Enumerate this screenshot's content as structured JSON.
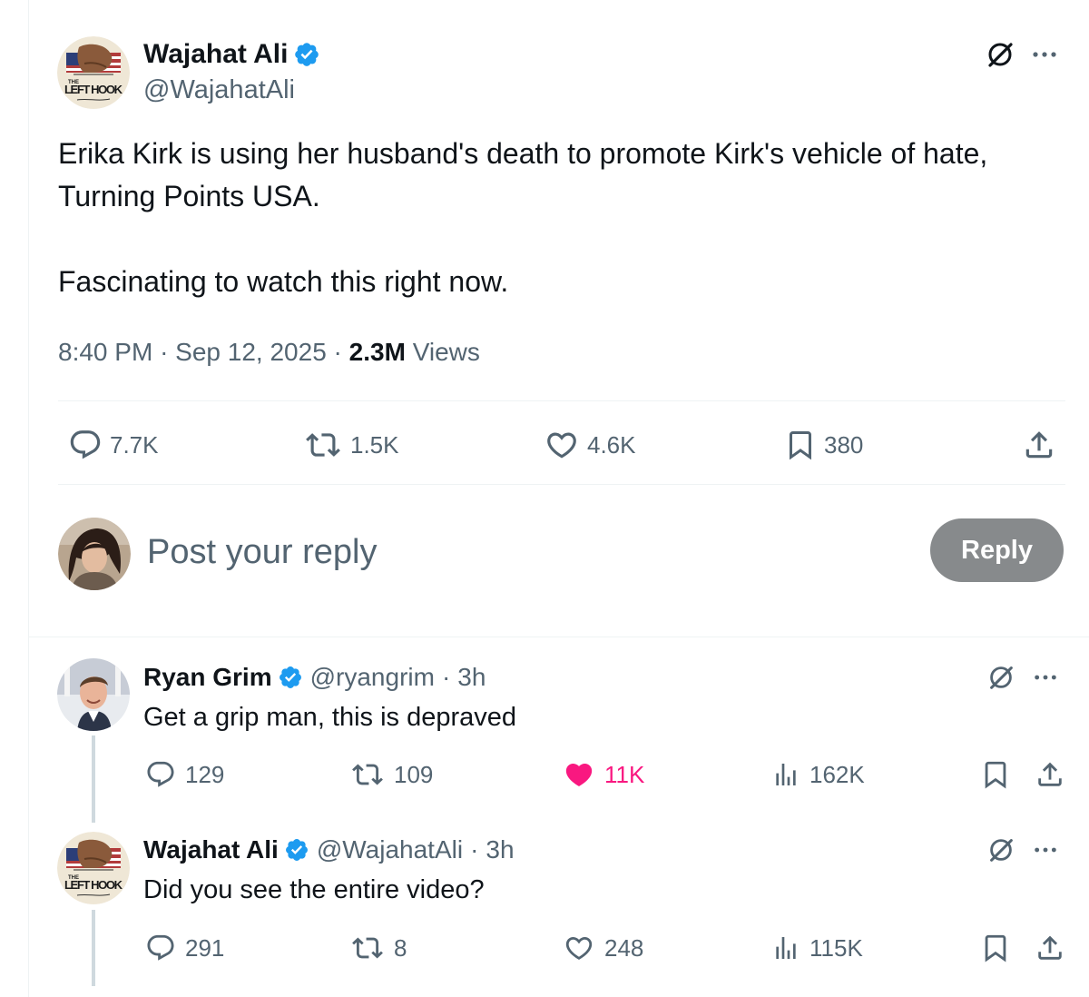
{
  "main_tweet": {
    "author_name": "Wajahat Ali",
    "author_handle": "@WajahatAli",
    "avatar_text_top": "THE",
    "avatar_text_main": "LEFT HOOK",
    "text_paragraphs": [
      "Erika Kirk is using her husband's death to promote Kirk's vehicle of hate, Turning Points USA.",
      "Fascinating to watch this right now."
    ],
    "time": "8:40 PM",
    "date": "Sep 12, 2025",
    "separator": "·",
    "views_count": "2.3M",
    "views_label": "Views",
    "stats": {
      "replies": "7.7K",
      "reposts": "1.5K",
      "likes": "4.6K",
      "bookmarks": "380"
    }
  },
  "composer": {
    "placeholder": "Post your reply",
    "button_label": "Reply"
  },
  "replies": [
    {
      "author_name": "Ryan Grim",
      "author_handle": "@ryangrim",
      "separator": "·",
      "time": "3h",
      "text": "Get a grip man, this is depraved",
      "stats": {
        "replies": "129",
        "reposts": "109",
        "likes": "11K",
        "views": "162K"
      },
      "liked": true
    },
    {
      "author_name": "Wajahat Ali",
      "author_handle": "@WajahatAli",
      "separator": "·",
      "time": "3h",
      "text": "Did you see the entire video?",
      "stats": {
        "replies": "291",
        "reposts": "8",
        "likes": "248",
        "views": "115K"
      },
      "liked": false
    }
  ],
  "colors": {
    "verified": "#1d9bf0",
    "muted": "#536471",
    "like_active": "#f91880",
    "reply_button": "#878a8c",
    "divider": "#eff3f4"
  },
  "icons": [
    "grok-icon",
    "more-icon",
    "reply-icon",
    "repost-icon",
    "like-icon",
    "bookmark-icon",
    "share-icon",
    "views-icon",
    "verified-badge-icon"
  ]
}
